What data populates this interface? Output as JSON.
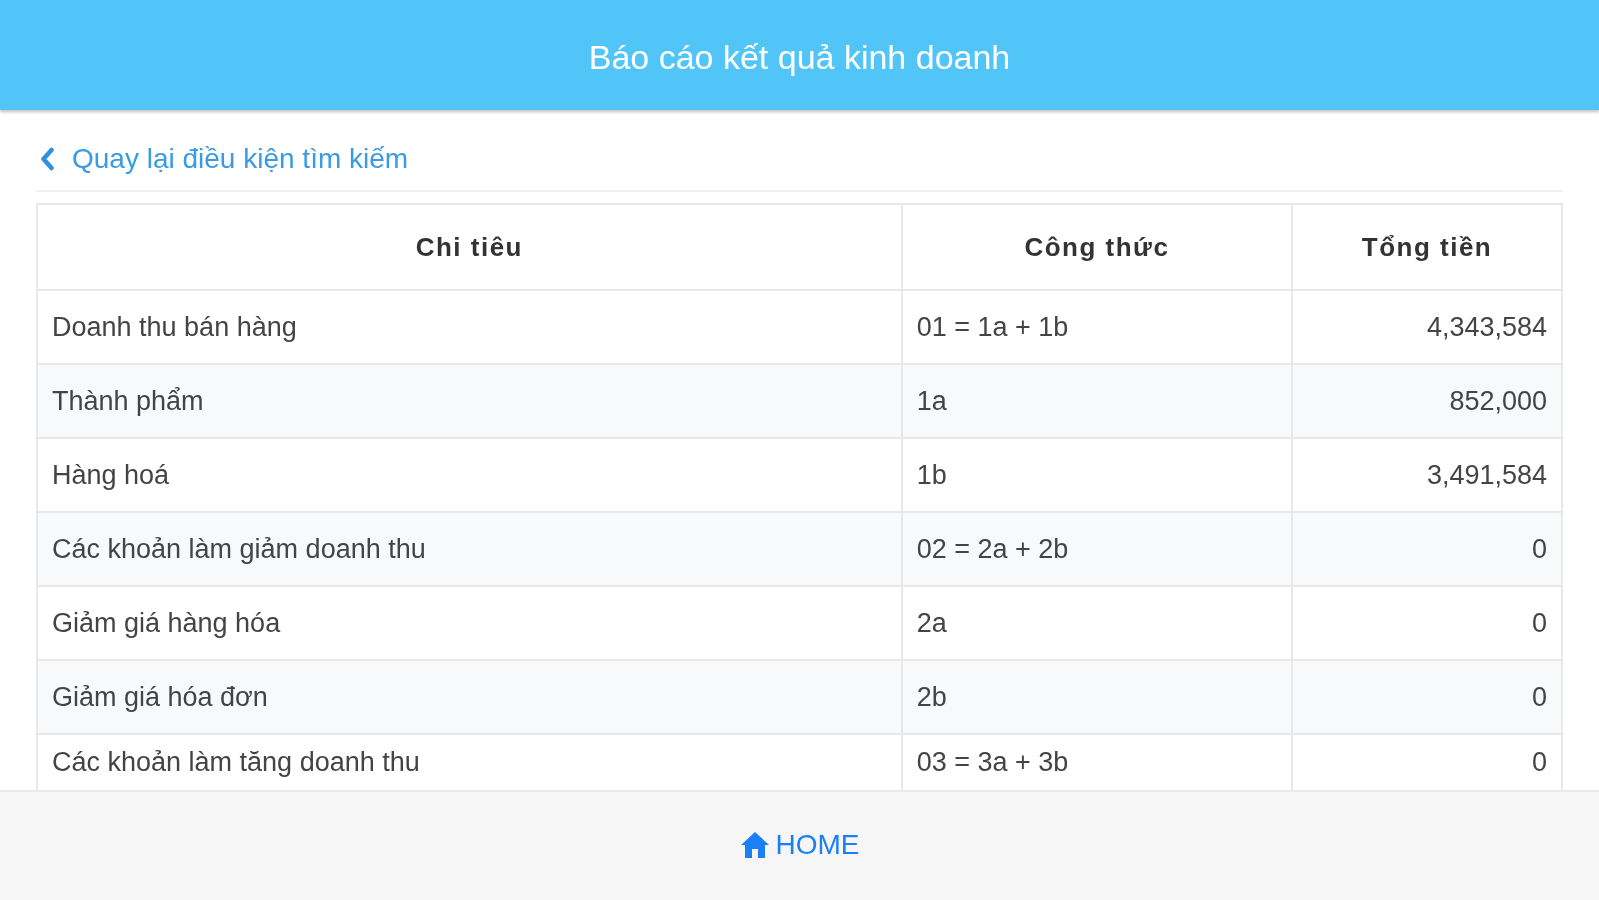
{
  "header": {
    "title": "Báo cáo kết quả kinh doanh"
  },
  "back_link": {
    "label": "Quay lại điều kiện tìm kiếm"
  },
  "table": {
    "columns": [
      "Chi tiêu",
      "Công thức",
      "Tổng tiền"
    ],
    "rows": [
      {
        "cells": [
          "Doanh thu bán hàng",
          "01 = 1a + 1b",
          "4,343,584"
        ]
      },
      {
        "cells": [
          "Thành phẩm",
          "1a",
          "852,000"
        ]
      },
      {
        "cells": [
          "Hàng hoá",
          "1b",
          "3,491,584"
        ]
      },
      {
        "cells": [
          "Các khoản làm giảm doanh thu",
          "02 = 2a + 2b",
          "0"
        ]
      },
      {
        "cells": [
          "Giảm giá hàng hóa",
          "2a",
          "0"
        ]
      },
      {
        "cells": [
          "Giảm giá hóa đơn",
          "2b",
          "0"
        ]
      },
      {
        "cells": [
          "Các khoản làm tăng doanh thu",
          "03 = 3a + 3b",
          "0"
        ]
      }
    ]
  },
  "footer": {
    "home": {
      "label": "HOME"
    }
  }
}
